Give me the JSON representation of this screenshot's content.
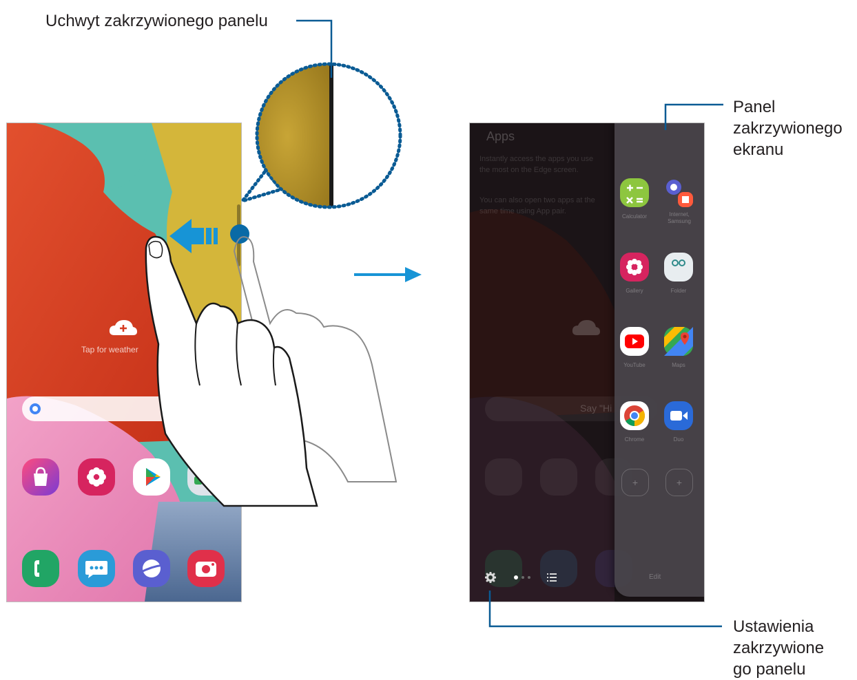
{
  "callouts": {
    "edge_handle": "Uchwyt zakrzywionego panelu",
    "edge_panel": [
      "Panel",
      "zakrzywionego",
      "ekranu"
    ],
    "edge_settings": [
      "Ustawienia",
      "zakrzywione",
      "go panelu"
    ]
  },
  "left_screen": {
    "weather_widget_text": "Tap for weather",
    "search_bar_icon": "google-g-icon",
    "home_apps": [
      "galaxy-store-icon",
      "gallery-icon",
      "play-store-icon",
      "google-folder-icon"
    ],
    "dock_apps": [
      "phone-icon",
      "messages-icon",
      "internet-icon",
      "camera-icon"
    ]
  },
  "right_screen": {
    "background_title": "Apps",
    "background_description_1": "Instantly access the apps you use the most on the Edge screen.",
    "background_description_2": "You can also open two apps at the same time using App pair.",
    "search_text": "Say \"Hi",
    "edge_panel_apps": [
      {
        "icon": "calculator-icon",
        "label": "Calculator",
        "color": "#8dc63f"
      },
      {
        "icon": "samsung-notes-internet-pair-icon",
        "label": "Internet, Samsung Notes",
        "color": "#5a5fd0"
      },
      {
        "icon": "gallery-icon",
        "label": "Gallery",
        "color": "#d6245f"
      },
      {
        "icon": "folder-icon",
        "label": "Folder",
        "color": "#e8edf0"
      },
      {
        "icon": "youtube-icon",
        "label": "YouTube",
        "color": "#ff0000"
      },
      {
        "icon": "maps-icon",
        "label": "Maps",
        "color": "#34a853"
      },
      {
        "icon": "chrome-icon",
        "label": "Chrome",
        "color": "#4285f4"
      },
      {
        "icon": "duo-icon",
        "label": "Duo",
        "color": "#2a6ad8"
      }
    ],
    "edge_settings_icon": "gear-icon",
    "page_indicator_count": 3,
    "list_icon": "list-icon",
    "edit_label": "Edit"
  },
  "colors": {
    "accent": "#0a6aa6",
    "arrow": "#1794d6",
    "left_wallpaper_red": "#d63a20",
    "left_wallpaper_teal": "#5bbfb0",
    "left_wallpaper_yellow": "#d4b63a"
  }
}
